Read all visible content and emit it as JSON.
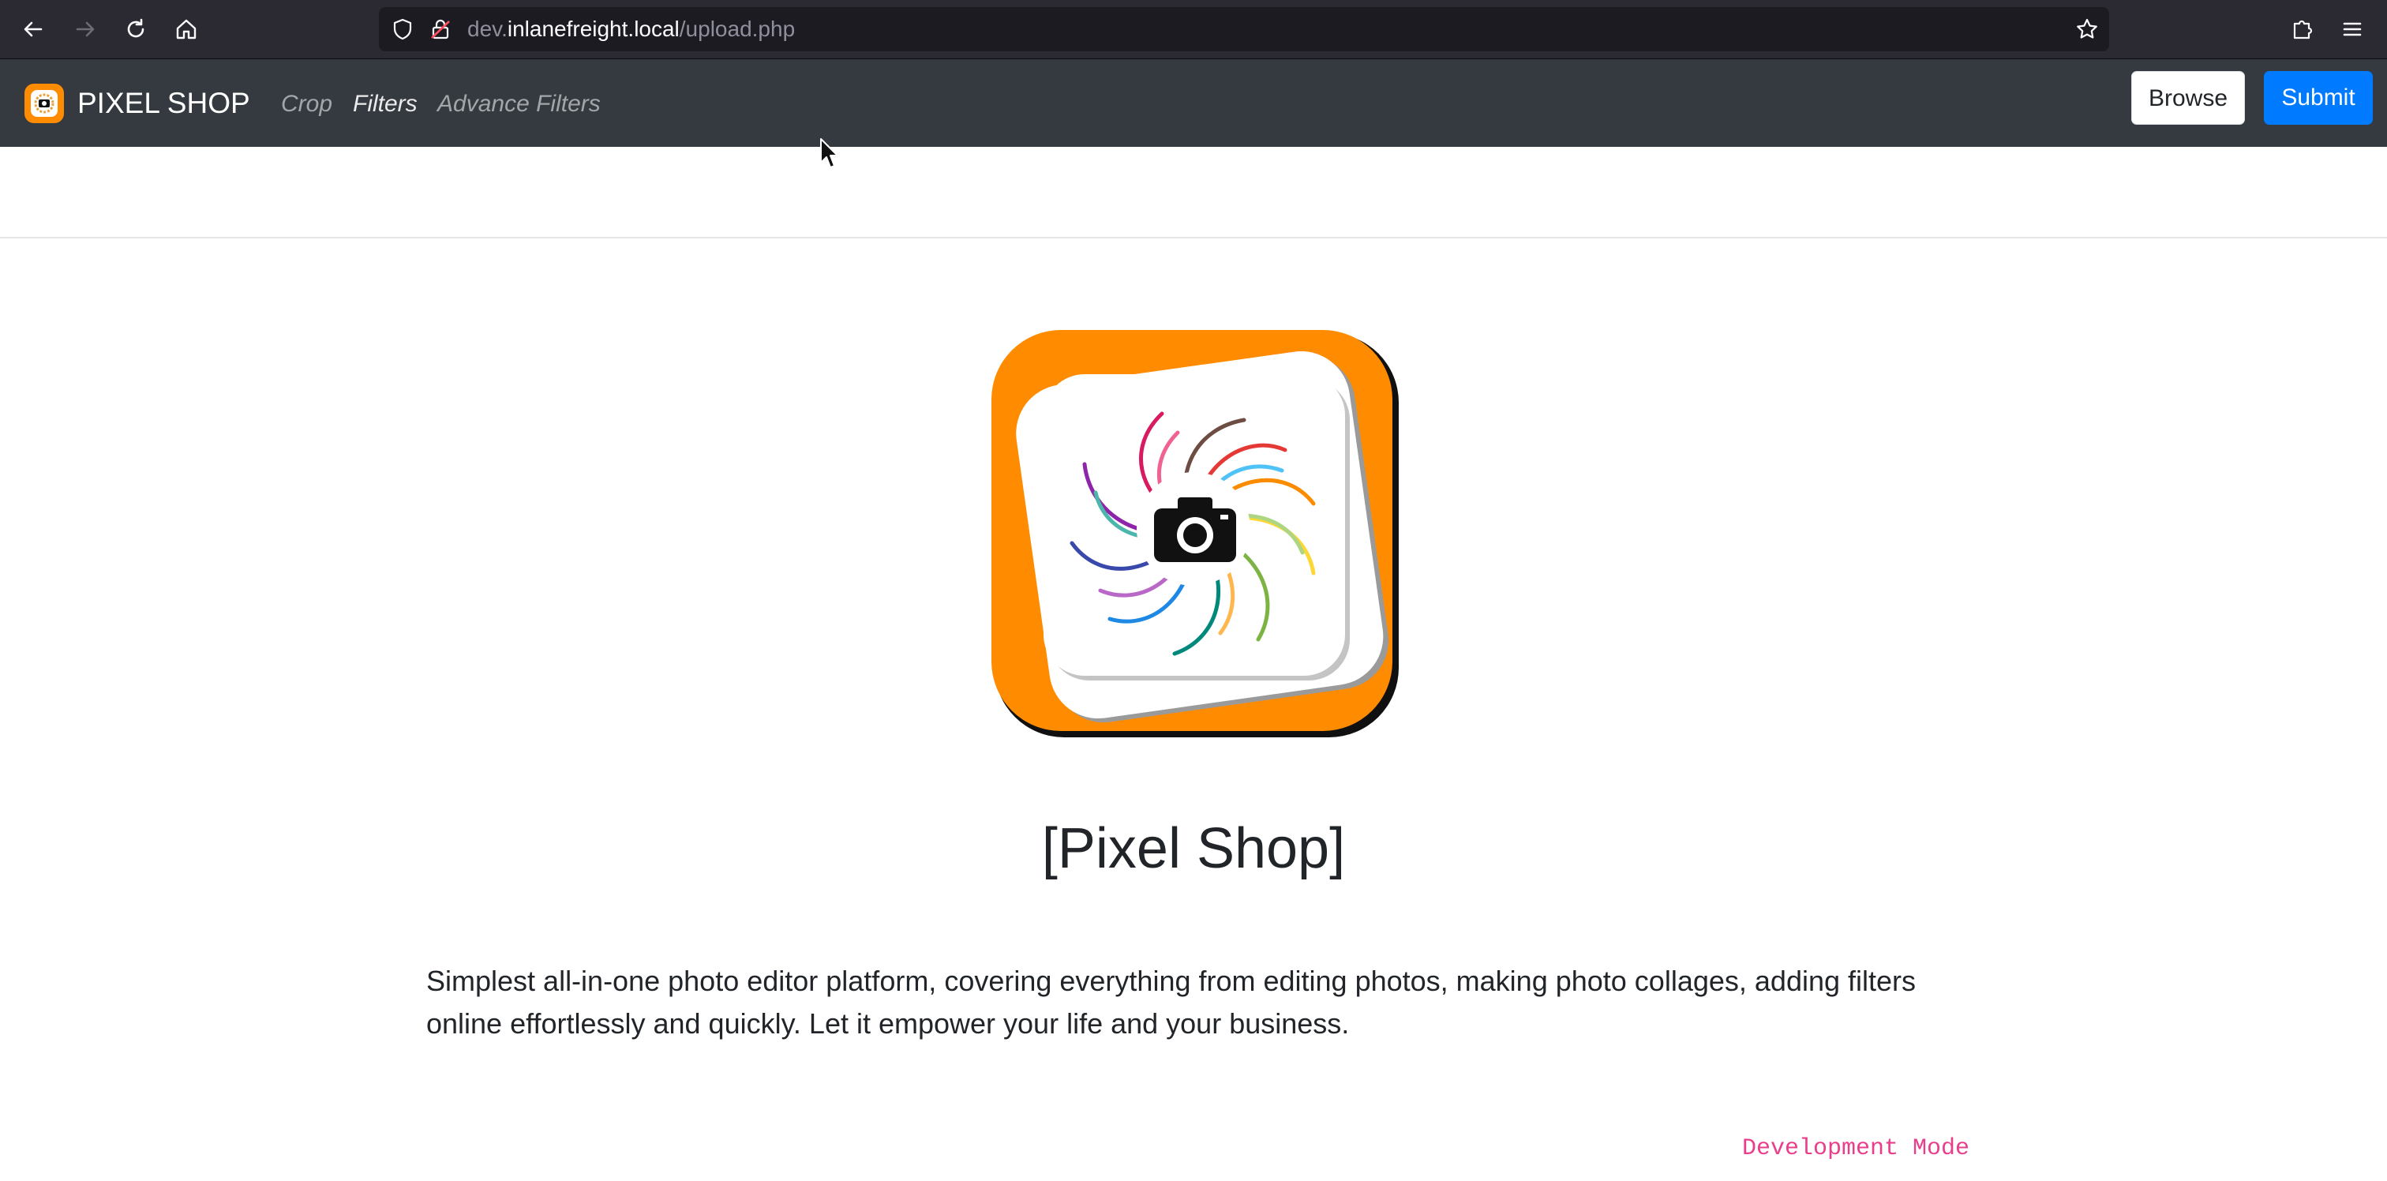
{
  "browser": {
    "url_prefix": "dev.",
    "url_host": "inlanefreight.local",
    "url_path": "/upload.php",
    "controls": [
      "back-icon",
      "forward-icon",
      "reload-icon",
      "home-icon",
      "shield-icon",
      "lock-icon",
      "bookmark-star-icon",
      "extensions-icon",
      "menu-icon"
    ]
  },
  "navbar": {
    "brand": "PIXEL SHOP",
    "links": [
      {
        "label": "Crop",
        "state": "muted"
      },
      {
        "label": "Filters",
        "state": "active"
      },
      {
        "label": "Advance Filters",
        "state": "muted"
      }
    ],
    "browse_label": "Browse",
    "submit_label": "Submit"
  },
  "main": {
    "logo_icon": "camera-swirl-logo",
    "title": "[Pixel Shop]",
    "description": "Simplest all-in-one photo editor platform, covering everything from editing photos, making photo collages, adding filters online effortlessly and quickly. Let it empower your life and your business.",
    "dev_mode": "Development Mode"
  },
  "colors": {
    "chrome_bg": "#2b2a33",
    "navbar_bg": "#343a40",
    "submit_bg": "#007bff",
    "logo_orange": "#ff8c00",
    "dev_mode": "#e83e8c"
  }
}
